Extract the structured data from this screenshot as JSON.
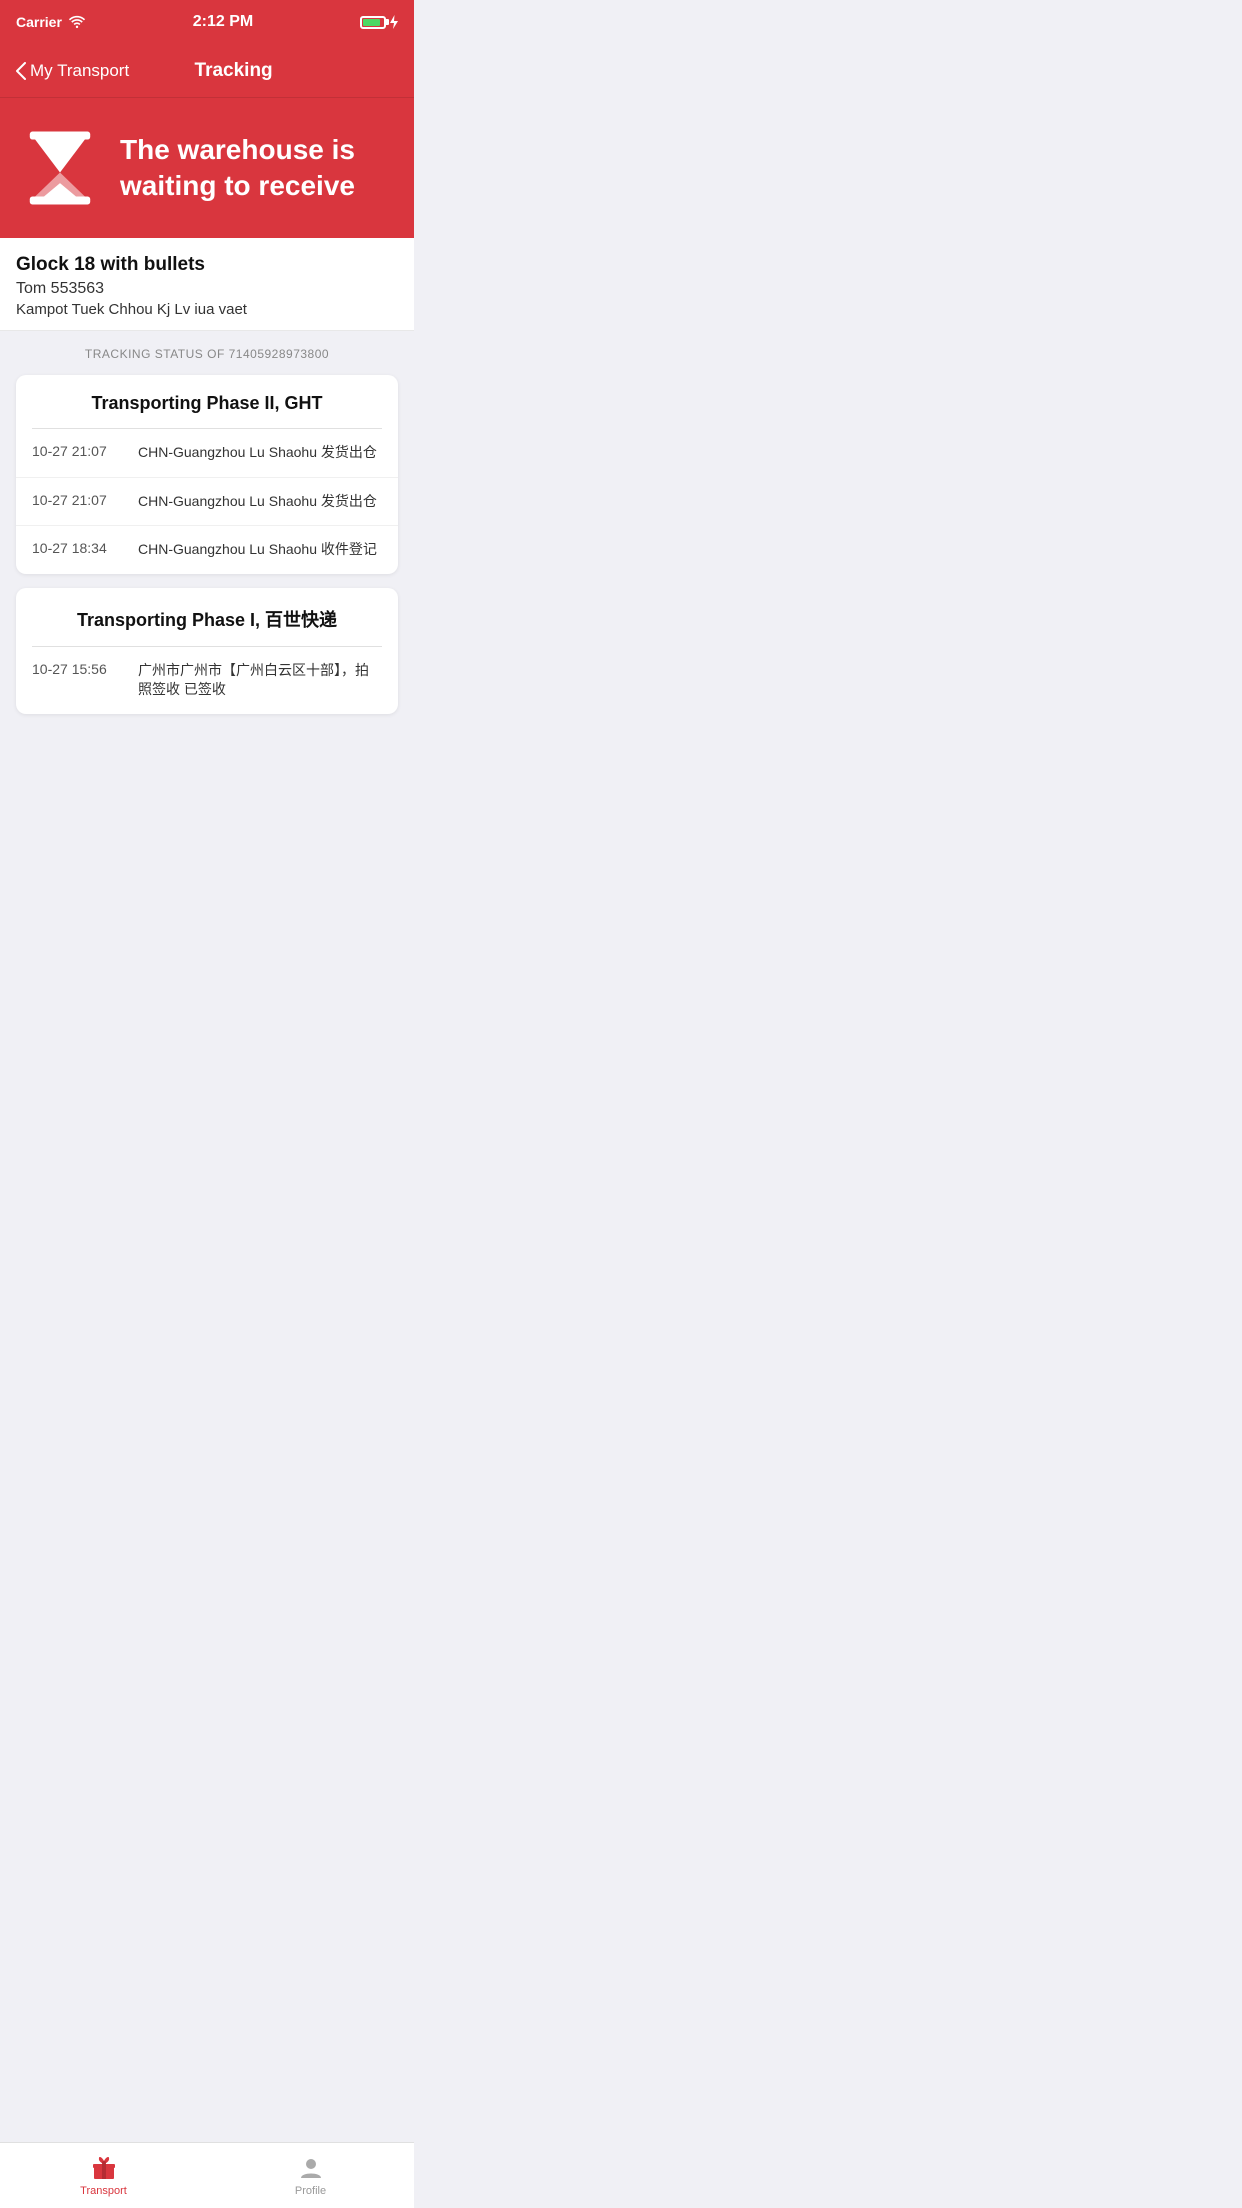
{
  "statusBar": {
    "carrier": "Carrier",
    "time": "2:12 PM"
  },
  "nav": {
    "backLabel": "My Transport",
    "title": "Tracking"
  },
  "banner": {
    "statusText": "The warehouse is waiting to receive"
  },
  "package": {
    "name": "Glock 18 with bullets",
    "sender": "Tom 553563",
    "address": "Kampot Tuek Chhou Kj Lv iua vaet"
  },
  "tracking": {
    "trackingLabel": "TRACKING STATUS OF 71405928973800",
    "phases": [
      {
        "title": "Transporting Phase II, GHT",
        "entries": [
          {
            "time": "10-27 21:07",
            "desc": "CHN-Guangzhou Lu Shaohu 发货出仓"
          },
          {
            "time": "10-27 21:07",
            "desc": "CHN-Guangzhou Lu Shaohu 发货出仓"
          },
          {
            "time": "10-27 18:34",
            "desc": "CHN-Guangzhou Lu Shaohu 收件登记"
          }
        ]
      },
      {
        "title": "Transporting Phase I, 百世快递",
        "entries": [
          {
            "time": "10-27 15:56",
            "desc": "广州市广州市【广州白云区十部】，拍照签收 已签收"
          }
        ]
      }
    ]
  },
  "tabBar": {
    "tabs": [
      {
        "label": "Transport",
        "active": true
      },
      {
        "label": "Profile",
        "active": false
      }
    ]
  }
}
